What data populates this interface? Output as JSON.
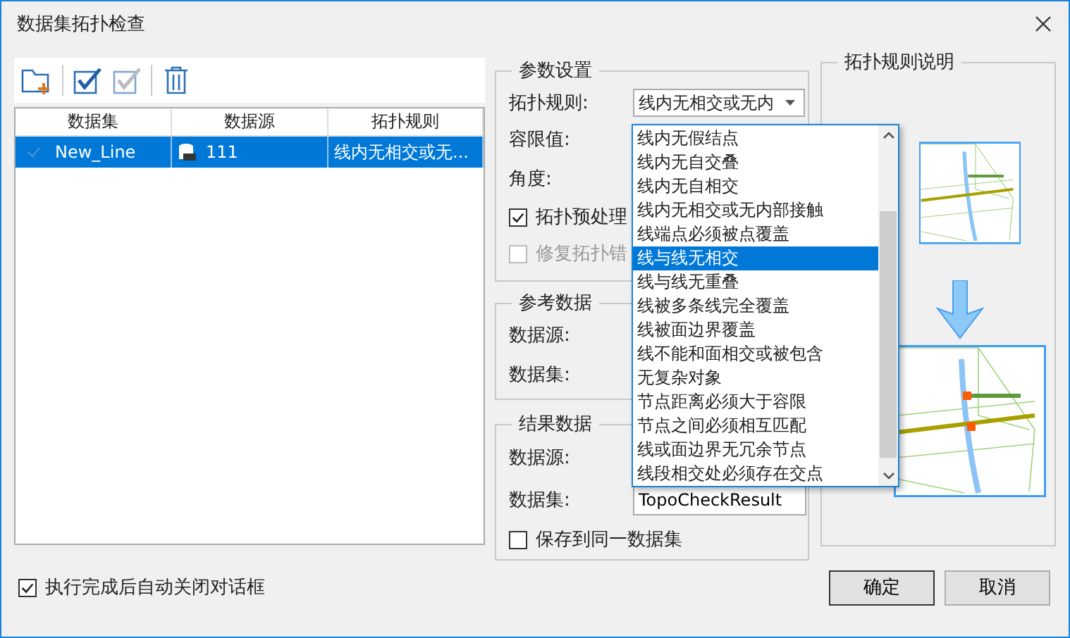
{
  "window": {
    "title": "数据集拓扑检查"
  },
  "table": {
    "columns": [
      "数据集",
      "数据源",
      "拓扑规则"
    ],
    "rows": [
      {
        "dataset": "New_Line",
        "source": "111",
        "rule": "线内无相交或无...",
        "selected": true
      }
    ]
  },
  "params": {
    "legend": "参数设置",
    "rule_label": "拓扑规则:",
    "rule_value": "线内无相交或无内",
    "tolerance_label": "容限值:",
    "angle_label": "角度:",
    "checkboxes": [
      {
        "label": "拓扑预处理",
        "checked": true,
        "disabled": false
      },
      {
        "label": "修复拓扑错",
        "checked": false,
        "disabled": true
      }
    ]
  },
  "reference": {
    "legend": "参考数据",
    "source_label": "数据源:",
    "dataset_label": "数据集:"
  },
  "result": {
    "legend": "结果数据",
    "source_label": "数据源:",
    "dataset_label": "数据集:",
    "dataset_value": "TopoCheckResult",
    "checkbox": {
      "label": "保存到同一数据集",
      "checked": false
    }
  },
  "description": {
    "legend": "拓扑规则说明"
  },
  "dropdown": {
    "items": [
      {
        "label": "线内无假结点",
        "selected": false
      },
      {
        "label": "线内无自交叠",
        "selected": false
      },
      {
        "label": "线内无自相交",
        "selected": false
      },
      {
        "label": "线内无相交或无内部接触",
        "selected": false
      },
      {
        "label": "线端点必须被点覆盖",
        "selected": false
      },
      {
        "label": "线与线无相交",
        "selected": true
      },
      {
        "label": "线与线无重叠",
        "selected": false
      },
      {
        "label": "线被多条线完全覆盖",
        "selected": false
      },
      {
        "label": "线被面边界覆盖",
        "selected": false
      },
      {
        "label": "线不能和面相交或被包含",
        "selected": false
      },
      {
        "label": "无复杂对象",
        "selected": false
      },
      {
        "label": "节点距离必须大于容限",
        "selected": false
      },
      {
        "label": "节点之间必须相互匹配",
        "selected": false
      },
      {
        "label": "线或面边界无冗余节点",
        "selected": false
      },
      {
        "label": "线段相交处必须存在交点",
        "selected": false
      }
    ]
  },
  "footer": {
    "checkbox": {
      "label": "执行完成后自动关闭对话框",
      "checked": true
    },
    "buttons": [
      {
        "label": "确定",
        "default": true
      },
      {
        "label": "取消",
        "default": false
      }
    ]
  }
}
